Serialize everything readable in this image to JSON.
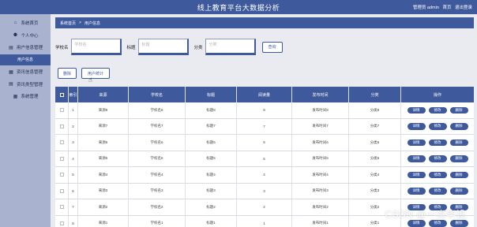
{
  "header": {
    "title": "线上教育平台大数据分析",
    "user_label": "管理员 admin",
    "profile_link": "首页",
    "logout_link": "退出登录"
  },
  "sidebar": {
    "items": [
      {
        "label": "系统首页",
        "icon": "home-icon",
        "glyph": "⌂",
        "active": false
      },
      {
        "label": "个人中心",
        "icon": "user-icon",
        "glyph": "⚉",
        "active": false
      },
      {
        "label": "用户信息管理",
        "icon": "list-icon",
        "glyph": "▤",
        "active": false
      },
      {
        "label": "用户信息",
        "icon": "",
        "glyph": "",
        "active": true
      },
      {
        "label": "资讯信息管理",
        "icon": "grid-icon",
        "glyph": "▦",
        "active": false
      },
      {
        "label": "资讯类型管理",
        "icon": "grid-icon",
        "glyph": "▤",
        "active": false
      },
      {
        "label": "系统管理",
        "icon": "grid-icon",
        "glyph": "▦",
        "active": false
      }
    ]
  },
  "breadcrumb": {
    "root": "系统首页",
    "separator": ">",
    "current": "用户信息"
  },
  "search": {
    "fields": [
      {
        "label": "学校名",
        "placeholder": "学校名"
      },
      {
        "label": "标题",
        "placeholder": "标题"
      },
      {
        "label": "分类",
        "placeholder": "分类"
      }
    ],
    "button": "查询"
  },
  "actions": {
    "delete": "删除",
    "stats": "用户统计"
  },
  "table": {
    "columns": [
      "索引",
      "来源",
      "学校名",
      "标题",
      "阅读量",
      "发布时间",
      "分类",
      "操作"
    ],
    "rows": [
      {
        "idx": "1",
        "source": "来源8",
        "school": "学校名8",
        "title": "标题8",
        "reads": "8",
        "time": "发布时间8",
        "category": "分类8"
      },
      {
        "idx": "2",
        "source": "来源7",
        "school": "学校名7",
        "title": "标题7",
        "reads": "7",
        "time": "发布时间7",
        "category": "分类7"
      },
      {
        "idx": "3",
        "source": "来源6",
        "school": "学校名6",
        "title": "标题6",
        "reads": "6",
        "time": "发布时间6",
        "category": "分类6"
      },
      {
        "idx": "4",
        "source": "来源5",
        "school": "学校名5",
        "title": "标题5",
        "reads": "5",
        "time": "发布时间5",
        "category": "分类5"
      },
      {
        "idx": "5",
        "source": "来源4",
        "school": "学校名4",
        "title": "标题4",
        "reads": "4",
        "time": "发布时间4",
        "category": "分类4"
      },
      {
        "idx": "6",
        "source": "来源3",
        "school": "学校名3",
        "title": "标题3",
        "reads": "3",
        "time": "发布时间3",
        "category": "分类3"
      },
      {
        "idx": "7",
        "source": "来源2",
        "school": "学校名2",
        "title": "标题2",
        "reads": "2",
        "time": "发布时间2",
        "category": "分类2"
      },
      {
        "idx": "8",
        "source": "来源1",
        "school": "学校名1",
        "title": "标题1",
        "reads": "1",
        "time": "发布时间1",
        "category": "分类1"
      }
    ],
    "row_actions": [
      "详情",
      "修改",
      "删除"
    ]
  },
  "watermark": "CSDN @一点毕设",
  "colors": {
    "primary": "#3f5a9c",
    "sidebar": "#a9b3cf",
    "background": "#e9ebf1"
  }
}
